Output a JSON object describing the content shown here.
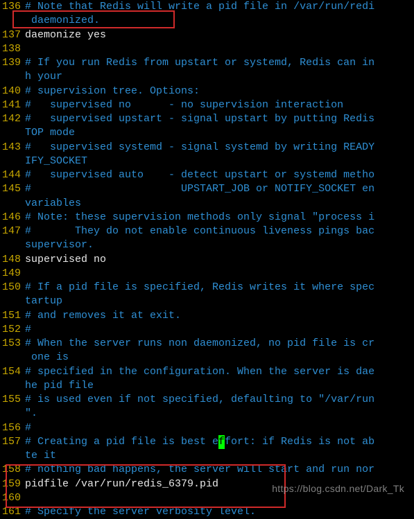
{
  "lines": [
    {
      "ln": "136",
      "parts": [
        [
          "comment",
          "# Note that Redis will write a pid file in /var/run/redi"
        ]
      ]
    },
    {
      "ln": "",
      "parts": [
        [
          "comment",
          " daemonized."
        ]
      ]
    },
    {
      "ln": "137",
      "parts": [
        [
          "code",
          "daemonize yes"
        ]
      ]
    },
    {
      "ln": "138",
      "parts": [
        [
          "code",
          ""
        ]
      ]
    },
    {
      "ln": "139",
      "parts": [
        [
          "comment",
          "# If you run Redis from upstart or systemd, Redis can in"
        ]
      ]
    },
    {
      "ln": "",
      "parts": [
        [
          "comment",
          "h your"
        ]
      ]
    },
    {
      "ln": "140",
      "parts": [
        [
          "comment",
          "# supervision tree. Options:"
        ]
      ]
    },
    {
      "ln": "141",
      "parts": [
        [
          "comment",
          "#   supervised no      - no supervision interaction"
        ]
      ]
    },
    {
      "ln": "142",
      "parts": [
        [
          "comment",
          "#   supervised upstart - signal upstart by putting Redis"
        ]
      ]
    },
    {
      "ln": "",
      "parts": [
        [
          "comment",
          "TOP mode"
        ]
      ]
    },
    {
      "ln": "143",
      "parts": [
        [
          "comment",
          "#   supervised systemd - signal systemd by writing READY"
        ]
      ]
    },
    {
      "ln": "",
      "parts": [
        [
          "comment",
          "IFY_SOCKET"
        ]
      ]
    },
    {
      "ln": "144",
      "parts": [
        [
          "comment",
          "#   supervised auto    - detect upstart or systemd metho"
        ]
      ]
    },
    {
      "ln": "145",
      "parts": [
        [
          "comment",
          "#                        UPSTART_JOB or NOTIFY_SOCKET en"
        ]
      ]
    },
    {
      "ln": "",
      "parts": [
        [
          "comment",
          "variables"
        ]
      ]
    },
    {
      "ln": "146",
      "parts": [
        [
          "comment",
          "# Note: these supervision methods only signal \"process i"
        ]
      ]
    },
    {
      "ln": "147",
      "parts": [
        [
          "comment",
          "#       They do not enable continuous liveness pings bac"
        ]
      ]
    },
    {
      "ln": "",
      "parts": [
        [
          "comment",
          "supervisor."
        ]
      ]
    },
    {
      "ln": "148",
      "parts": [
        [
          "code",
          "supervised no"
        ]
      ]
    },
    {
      "ln": "149",
      "parts": [
        [
          "code",
          ""
        ]
      ]
    },
    {
      "ln": "150",
      "parts": [
        [
          "comment",
          "# If a pid file is specified, Redis writes it where spec"
        ]
      ]
    },
    {
      "ln": "",
      "parts": [
        [
          "comment",
          "tartup"
        ]
      ]
    },
    {
      "ln": "151",
      "parts": [
        [
          "comment",
          "# and removes it at exit."
        ]
      ]
    },
    {
      "ln": "152",
      "parts": [
        [
          "comment",
          "#"
        ]
      ]
    },
    {
      "ln": "153",
      "parts": [
        [
          "comment",
          "# When the server runs non daemonized, no pid file is cr"
        ]
      ]
    },
    {
      "ln": "",
      "parts": [
        [
          "comment",
          " one is"
        ]
      ]
    },
    {
      "ln": "154",
      "parts": [
        [
          "comment",
          "# specified in the configuration. When the server is dae"
        ]
      ]
    },
    {
      "ln": "",
      "parts": [
        [
          "comment",
          "he pid file"
        ]
      ]
    },
    {
      "ln": "155",
      "parts": [
        [
          "comment",
          "# is used even if not specified, defaulting to \"/var/run"
        ]
      ]
    },
    {
      "ln": "",
      "parts": [
        [
          "comment",
          "\"."
        ]
      ]
    },
    {
      "ln": "156",
      "parts": [
        [
          "comment",
          "#"
        ]
      ]
    },
    {
      "ln": "157",
      "parts": [
        [
          "comment",
          "# Creating a pid file is best e"
        ],
        [
          "cursor",
          "f"
        ],
        [
          "comment",
          "fort: if Redis is not ab"
        ]
      ]
    },
    {
      "ln": "",
      "parts": [
        [
          "comment",
          "te it"
        ]
      ]
    },
    {
      "ln": "158",
      "parts": [
        [
          "comment",
          "# nothing bad happens, the server will start and run nor"
        ]
      ]
    },
    {
      "ln": "159",
      "parts": [
        [
          "code",
          "pidfile /var/run/redis_6379.pid"
        ]
      ]
    },
    {
      "ln": "160",
      "parts": [
        [
          "code",
          ""
        ]
      ]
    },
    {
      "ln": "161",
      "parts": [
        [
          "comment",
          "# Specify the server verbosity level."
        ]
      ]
    }
  ],
  "watermark": "https://blog.csdn.net/Dark_Tk"
}
